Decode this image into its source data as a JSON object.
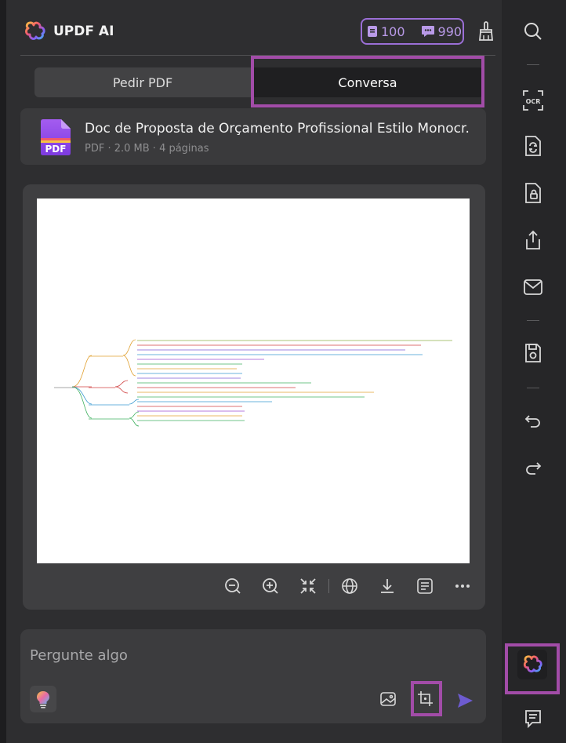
{
  "header": {
    "title": "UPDF AI",
    "doc_credits": "100",
    "chat_credits": "990"
  },
  "tabs": {
    "ask": "Pedir PDF",
    "chat": "Conversa"
  },
  "file": {
    "name": "Doc de Proposta de Orçamento Profissional Estilo Monocr...",
    "meta": "PDF · 2.0 MB · 4 páginas",
    "badge": "PDF"
  },
  "input": {
    "placeholder": "Pergunte algo"
  },
  "colors": {
    "accent": "#a24ca8",
    "credit": "#b99ae8",
    "send": "#6d5bd0"
  },
  "icons": {
    "rail": [
      "search-icon",
      "ocr-icon",
      "convert-icon",
      "protect-icon",
      "share-icon",
      "mail-icon",
      "save-icon",
      "undo-icon",
      "redo-icon",
      "updf-ai-icon",
      "comment-icon"
    ],
    "toolbar": [
      "zoom-out-icon",
      "zoom-in-icon",
      "fit-icon",
      "translate-icon",
      "download-icon",
      "outline-icon",
      "more-icon"
    ]
  },
  "rail_labels": {
    "ocr": "OCR"
  }
}
